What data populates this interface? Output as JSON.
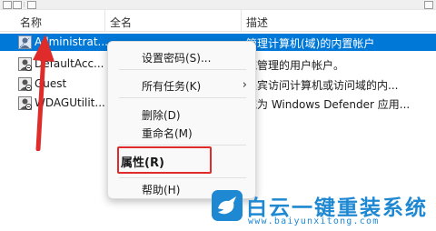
{
  "columns": {
    "name": "名称",
    "fullname": "全名",
    "description": "描述"
  },
  "rows": [
    {
      "name": "Administrat...",
      "description": "管理计算机(域)的内置帐户",
      "selected": true
    },
    {
      "name": "DefaultAcc...",
      "description": "统管理的用户帐户。",
      "selected": false
    },
    {
      "name": "Guest",
      "description": "来宾访问计算机或访问域的内...",
      "selected": false
    },
    {
      "name": "WDAGUtilit...",
      "description": "统为 Windows Defender 应用...",
      "selected": false
    }
  ],
  "context_menu": {
    "set_password": "设置密码(S)...",
    "all_tasks": "所有任务(K)",
    "all_tasks_arrow": "›",
    "delete": "删除(D)",
    "rename": "重命名(M)",
    "properties": "属性(R)",
    "help": "帮助(H)"
  },
  "highlight_color": "#e02b2b",
  "selection_color": "#0078d7",
  "watermark": {
    "title": "白云一键重装系统",
    "url": "www.baiyunxitong.com",
    "color": "#1e88d2"
  }
}
